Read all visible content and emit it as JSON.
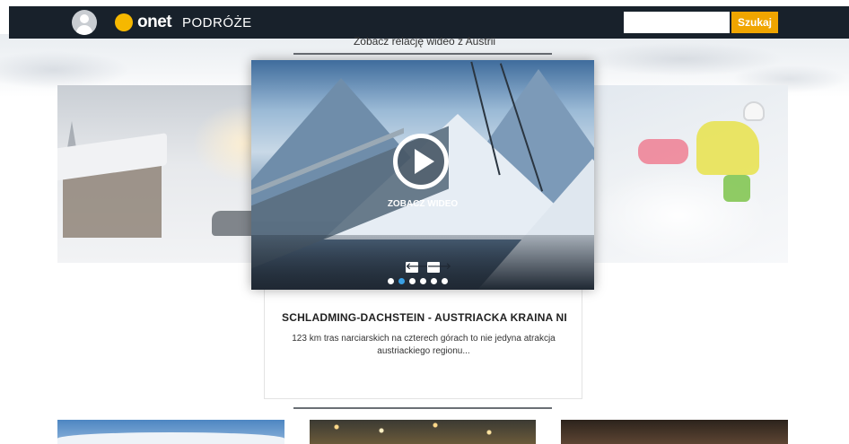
{
  "header": {
    "logo_brand": "onet",
    "logo_section": "PODRÓŻE",
    "search": {
      "placeholder": "",
      "value": "",
      "button_label": "Szukaj"
    },
    "icons": [
      "user-avatar-icon",
      "onet-logo-dot"
    ]
  },
  "section": {
    "title": "Zobacz relację wideo z Austrii"
  },
  "video": {
    "label": "ZOBACZ WIDEO",
    "prev_symbol": "🡐",
    "next_symbol": "🡒",
    "dots_total": 6,
    "active_dot": 2
  },
  "card": {
    "title": "SCHLADMING-DACHSTEIN - AUSTRIACKA KRAINA NIE T...",
    "description": "123 km tras narciarskich na czterech górach to nie jedyna atrakcja austriackiego regionu..."
  },
  "colors": {
    "header_bg": "#18212b",
    "brand_yellow": "#f6b800",
    "search_button": "#f0a500",
    "active_dot": "#3aa0e4"
  }
}
